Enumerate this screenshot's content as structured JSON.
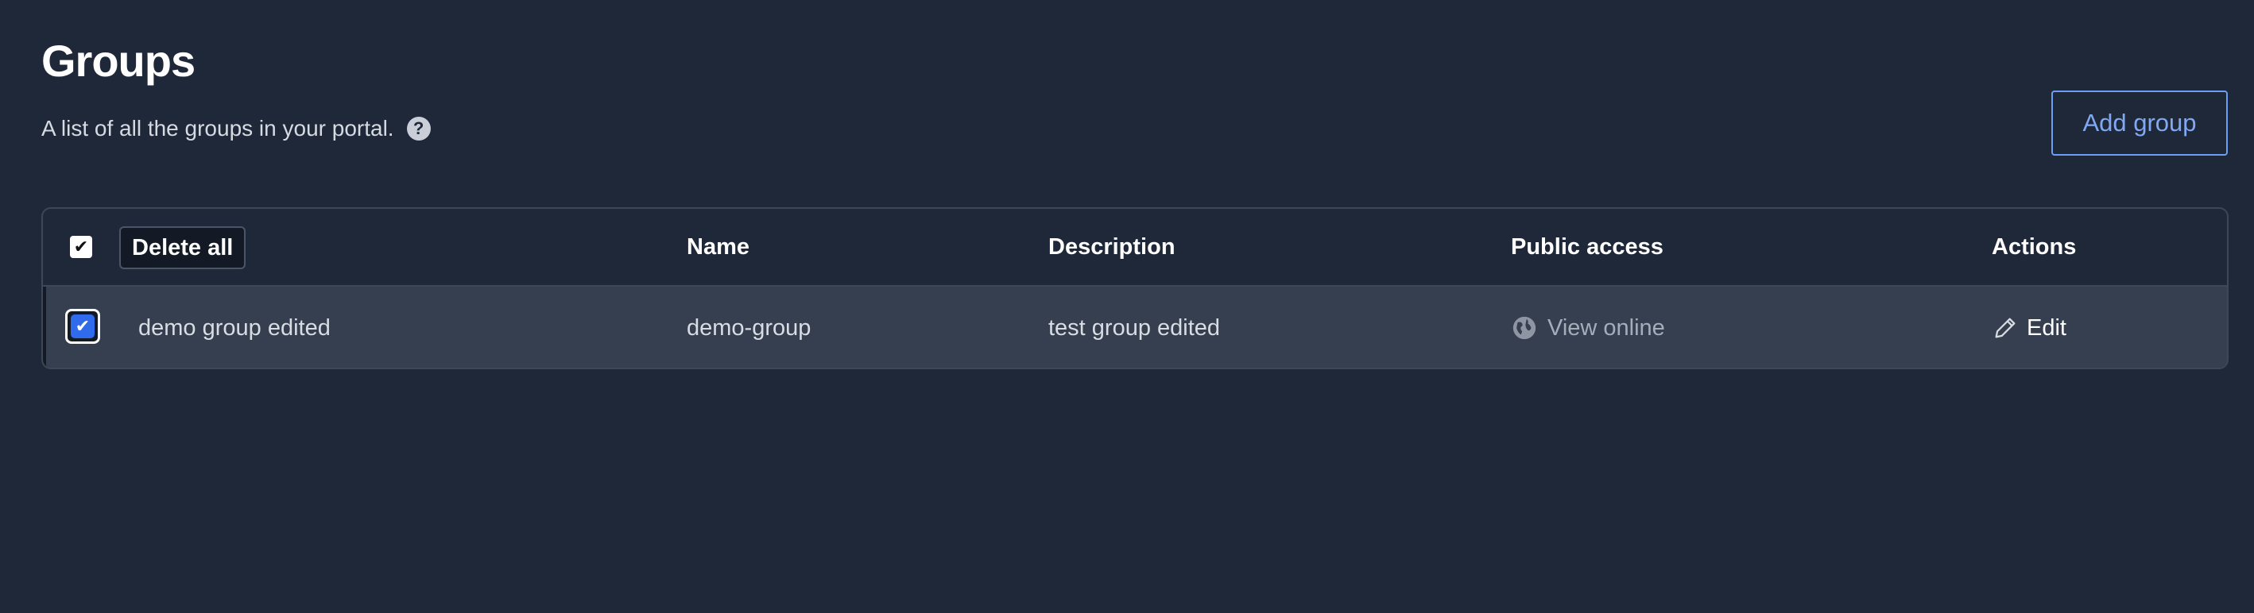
{
  "header": {
    "title": "Groups",
    "subtitle": "A list of all the groups in your portal.",
    "help_icon": "question-circle-icon",
    "help_glyph": "?",
    "add_button_label": "Add group"
  },
  "colors": {
    "background": "#1f2838",
    "accent": "#6b9ef5",
    "checkbox_checked": "#2f6bea",
    "row_selected_bg": "#363f4f"
  },
  "table": {
    "select_all_checked": true,
    "delete_all_label": "Delete all",
    "columns": [
      "Name",
      "Description",
      "Public access",
      "Actions"
    ],
    "rows": [
      {
        "checked": true,
        "title": "demo group edited",
        "name": "demo-group",
        "description": "test group edited",
        "public_access": "View online",
        "public_access_icon": "globe-icon",
        "action_label": "Edit",
        "action_icon": "pencil-icon"
      }
    ]
  }
}
